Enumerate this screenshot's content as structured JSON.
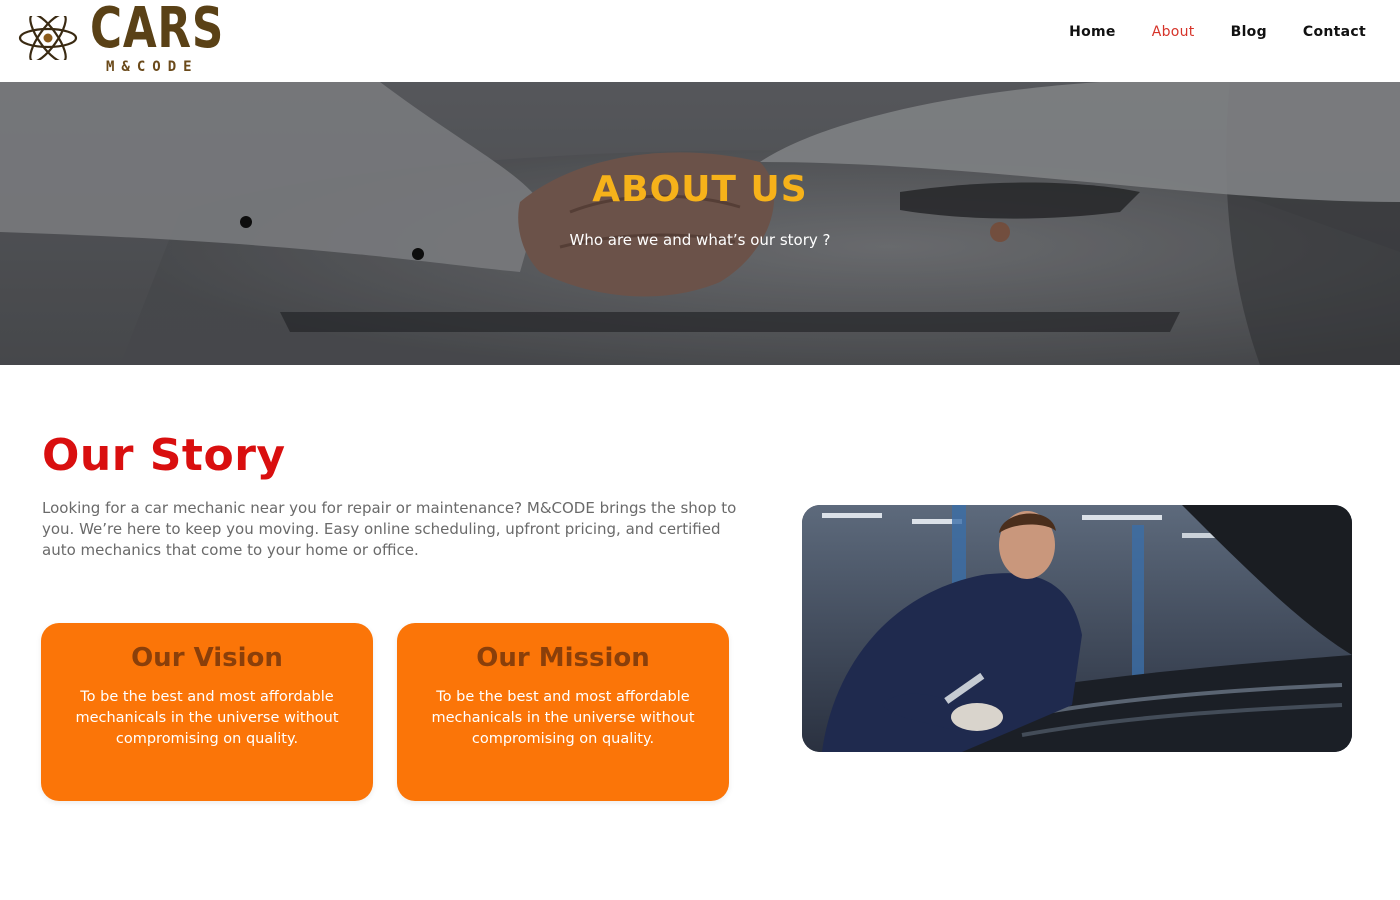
{
  "brand": {
    "name": "CARS",
    "sub": "M&CODE",
    "icon": "atom-icon",
    "colors": {
      "brand": "#5a4116"
    }
  },
  "nav": {
    "items": [
      {
        "label": "Home",
        "active": false
      },
      {
        "label": "About",
        "active": true
      },
      {
        "label": "Blog",
        "active": false
      },
      {
        "label": "Contact",
        "active": false
      }
    ]
  },
  "hero": {
    "title": "ABOUT US",
    "subtitle": "Who are we and what’s our story ?",
    "colors": {
      "title": "#f6b21a"
    }
  },
  "story": {
    "title": "Our Story",
    "text": "Looking for a car mechanic near you for repair or maintenance? M&CODE brings the shop to you. We’re here to keep you moving. Easy online scheduling, upfront pricing, and certified auto mechanics that come to your home or office.",
    "colors": {
      "title": "#d90f0f"
    }
  },
  "cards": {
    "vision": {
      "title": "Our Vision",
      "text": "To be the best and most affordable mechanicals in the universe without compromising on quality."
    },
    "mission": {
      "title": "Our Mission",
      "text": "To be the best and most affordable mechanicals in the universe without compromising on quality."
    },
    "colors": {
      "background": "#fb7508",
      "title": "#8a3f0a"
    }
  }
}
